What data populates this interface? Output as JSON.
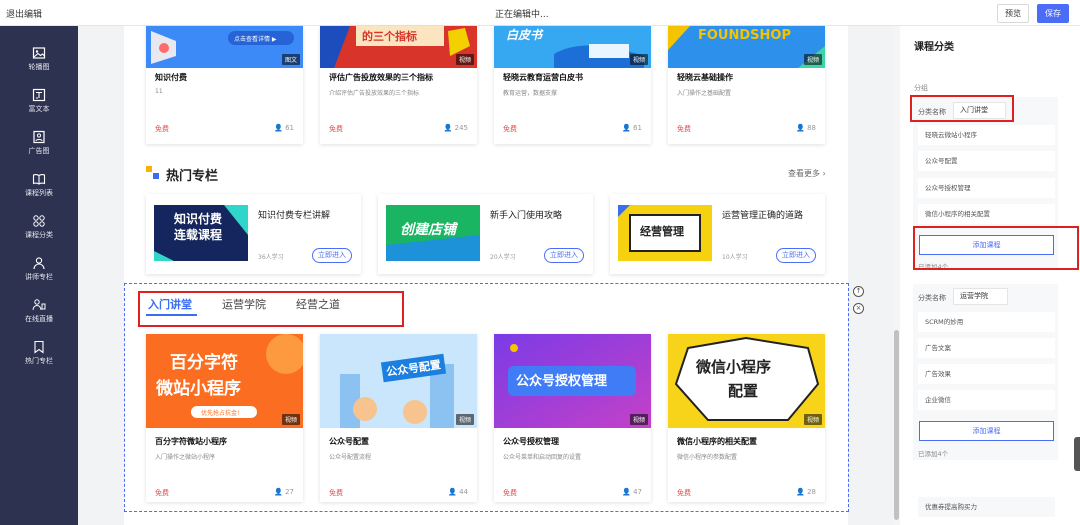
{
  "topbar": {
    "exit": "退出编辑",
    "status": "正在编辑中...",
    "preview": "预览",
    "save": "保存"
  },
  "sidebar": {
    "items": [
      {
        "label": "轮播图",
        "icon": "image-icon"
      },
      {
        "label": "富文本",
        "icon": "rich-text-icon"
      },
      {
        "label": "广告图",
        "icon": "ad-image-icon"
      },
      {
        "label": "课程列表",
        "icon": "book-icon"
      },
      {
        "label": "课程分类",
        "icon": "grid-icon"
      },
      {
        "label": "讲师专栏",
        "icon": "teacher-icon"
      },
      {
        "label": "在线直播",
        "icon": "live-icon"
      },
      {
        "label": "热门专栏",
        "icon": "bookmark-icon"
      }
    ]
  },
  "top_cards": [
    {
      "title": "知识付费",
      "sub": "11",
      "free": "免费",
      "count": "61",
      "badge": "图文",
      "banner": ""
    },
    {
      "title": "评估广告投放效果的三个指标",
      "sub": "介绍评估广告投放效果的三个指标",
      "free": "免费",
      "count": "245",
      "badge": "视频",
      "banner": "的三个指标"
    },
    {
      "title": "轻晓云教育运营白皮书",
      "sub": "教育运营，数据支撑",
      "free": "免费",
      "count": "61",
      "badge": "视频",
      "banner": "白皮书"
    },
    {
      "title": "轻晓云基础操作",
      "sub": "入门操作之基础配置",
      "free": "免费",
      "count": "88",
      "badge": "视频",
      "banner": "FOUNDSHOP"
    }
  ],
  "hot": {
    "title": "热门专栏",
    "more": "查看更多 ›",
    "columns": [
      {
        "title": "知识付费专栏讲解",
        "learn": "36人学习",
        "btn": "立即进入",
        "img": "知识付费\n连载课程"
      },
      {
        "title": "新手入门使用攻略",
        "learn": "20人学习",
        "btn": "立即进入",
        "img": "创建店铺"
      },
      {
        "title": "运营管理正确的道路",
        "learn": "10人学习",
        "btn": "立即进入",
        "img": "经营管理"
      }
    ]
  },
  "tabs": [
    {
      "label": "入门讲堂",
      "active": true
    },
    {
      "label": "运营学院",
      "active": false
    },
    {
      "label": "经营之道",
      "active": false
    }
  ],
  "bottom_cards": [
    {
      "title": "百分字符微站小程序",
      "sub": "入门操作之微站小程序",
      "free": "免费",
      "count": "27",
      "badge": "视频",
      "line1": "百分字符",
      "line2": "微站小程序",
      "tag": "优先抢占抗金!"
    },
    {
      "title": "公众号配置",
      "sub": "公众号配置流程",
      "free": "免费",
      "count": "44",
      "badge": "视频",
      "line1": "公众号配置"
    },
    {
      "title": "公众号授权管理",
      "sub": "公众号菜单和启动回复的设置",
      "free": "免费",
      "count": "47",
      "badge": "视频",
      "line1": "公众号授权管理"
    },
    {
      "title": "微信小程序的相关配置",
      "sub": "微信小程序的参数配置",
      "free": "免费",
      "count": "28",
      "badge": "视频",
      "line1": "微信小程序",
      "line2": "配置"
    }
  ],
  "panel": {
    "title": "课程分类",
    "group_label": "分组",
    "groups": [
      {
        "name_label": "分类名称",
        "name": "入门讲堂",
        "items": [
          "轻晓云微站小程序",
          "公众号配置",
          "公众号授权管理",
          "微信小程序的相关配置"
        ],
        "add": "添加课程",
        "added": "已添加4个"
      },
      {
        "name_label": "分类名称",
        "name": "运营学院",
        "items": [
          "SCRM的妙用",
          "广告文案",
          "广告效果",
          "企业微信"
        ],
        "add": "添加课程",
        "added": "已添加4个"
      }
    ],
    "extra_item": "优惠券提高购买力"
  },
  "colors": {
    "accent": "#4a6cf7",
    "sidebar": "#2d3250",
    "free": "#e8484a",
    "highlight": "#e02020"
  }
}
